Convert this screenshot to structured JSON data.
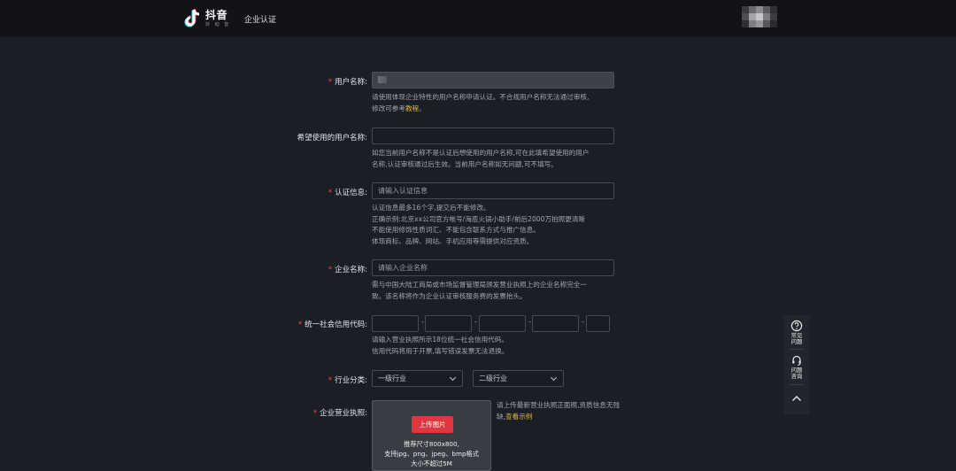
{
  "header": {
    "logo_main": "抖音",
    "logo_sub": "抖 动 音",
    "nav_title": "企业认证"
  },
  "form": {
    "username": {
      "label": "用户名称:",
      "hint_line1": "请使用体现企业特性的用户名称申请认证。不合规用户名称无法通过审核,",
      "hint_line2_prefix": "修改可参考",
      "hint_link": "教程",
      "hint_line2_suffix": "。"
    },
    "desired_name": {
      "label": "希望使用的用户名称:",
      "value": "",
      "hint_line1": "如您当前用户名称不是认证后想使用的用户名称,可在此填希望使用的用户",
      "hint_line2": "名称,认证审核通过后生效。当前用户名称如无问题,可不填写。"
    },
    "cert_info": {
      "label": "认证信息:",
      "placeholder": "请输入认证信息",
      "hint_lines": [
        "认证信息最多16个字,提交后不能修改。",
        "正确示例:北京xx公司官方帐号/海底火锅小助手/前后2000万拍照更清晰",
        "不能使用修饰性质词汇、不能包含联系方式与推广信息。",
        "体现商标、品牌、网站、手机应用等需提供对应资质。"
      ]
    },
    "company_name": {
      "label": "企业名称:",
      "placeholder": "请输入企业名称",
      "hint_line1": "需与中国大陆工商局或市场监督管理局颁发营业执照上的企业名称完全一",
      "hint_line2": "致。该名称将作为企业认证审核服务费的发票抬头。"
    },
    "credit_code": {
      "label": "统一社会信用代码:",
      "separator": "-",
      "segments": [
        "",
        "",
        "",
        "",
        ""
      ],
      "hint_line1": "请输入营业执照所示18位统一社会信用代码。",
      "hint_line2": "信用代码将用于开票,填写错误发票无法退换。"
    },
    "industry": {
      "label": "行业分类:",
      "primary": "一级行业",
      "secondary": "二级行业"
    },
    "license": {
      "label": "企业营业执照:",
      "upload_button": "上传图片",
      "upload_desc1": "推荐尺寸800x800,",
      "upload_desc2": "支持jpg、png、jpeg、bmp格式",
      "upload_desc3": "大小不超过5M",
      "hint_line1": "请上传最新营业执照正面照,资质信息无残",
      "hint_line2_prefix": "缺,",
      "hint_link": "查看示例"
    }
  },
  "floatbar": {
    "faq_label1": "常见",
    "faq_label2": "问题",
    "consult_label1": "问题",
    "consult_label2": "咨询"
  },
  "colors": {
    "background": "#1c1e26",
    "header": "#111318",
    "required": "#f0474c",
    "link": "#d9b93c",
    "upload_button": "#e0363f"
  }
}
